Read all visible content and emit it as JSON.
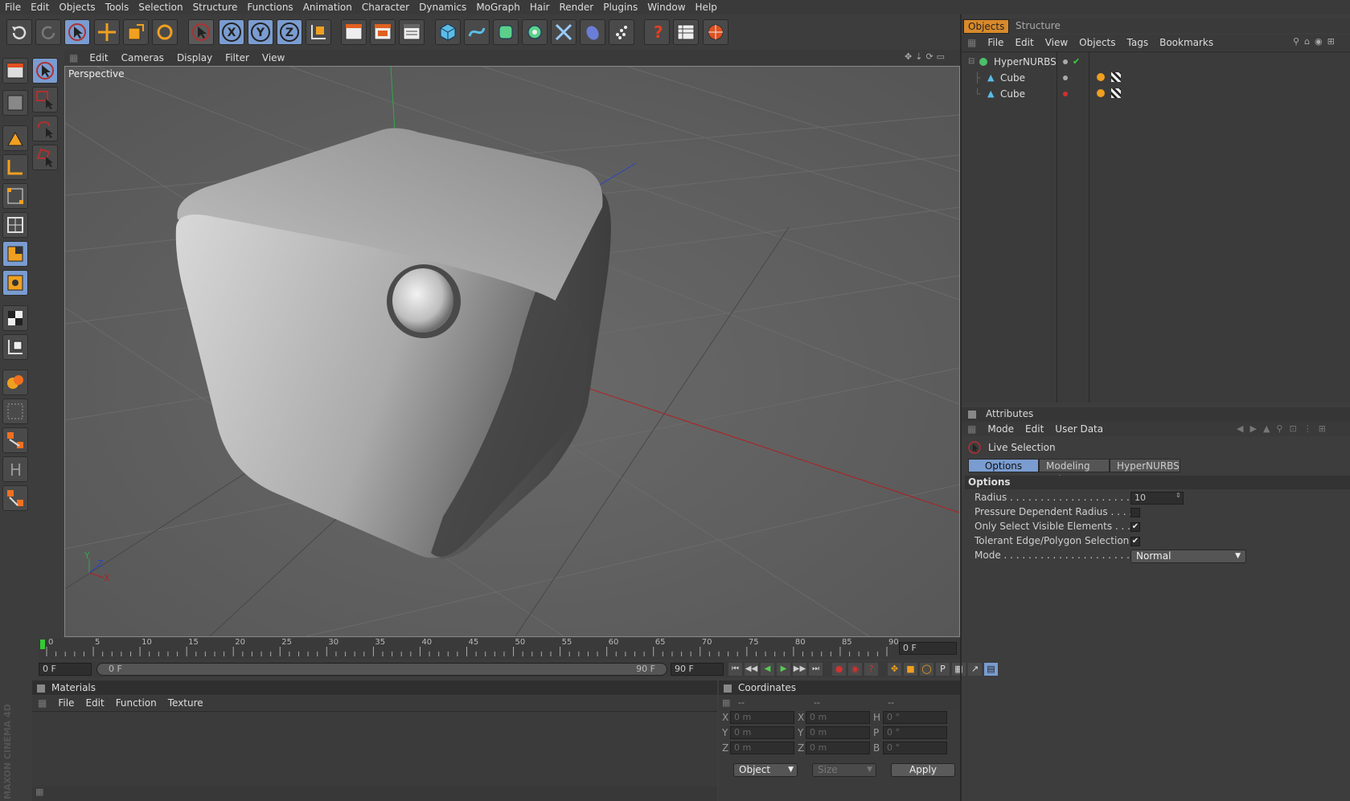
{
  "menubar": [
    "File",
    "Edit",
    "Objects",
    "Tools",
    "Selection",
    "Structure",
    "Functions",
    "Animation",
    "Character",
    "Dynamics",
    "MoGraph",
    "Hair",
    "Render",
    "Plugins",
    "Window",
    "Help"
  ],
  "toolbar": {
    "icons": [
      "undo-icon",
      "redo-icon",
      "live-selection-icon",
      "move-icon",
      "scale-icon",
      "rotate-icon",
      "last-tool-icon",
      "x-axis-icon",
      "y-axis-icon",
      "z-axis-icon",
      "coordinate-system-icon",
      "render-view-icon",
      "render-picture-viewer-icon",
      "render-settings-icon",
      "cube-primitive-icon",
      "spline-icon",
      "nurbs-icon",
      "modeling-icon",
      "deformer-icon",
      "scene-icon",
      "particles-icon",
      "help-icon",
      "timeline-icon",
      "internet-icon"
    ],
    "axis_x": "X",
    "axis_y": "Y",
    "axis_z": "Z"
  },
  "viewport": {
    "menu": [
      "Edit",
      "Cameras",
      "Display",
      "Filter",
      "View"
    ],
    "label": "Perspective",
    "axis_x": "X",
    "axis_y": "Y",
    "axis_z": "Z"
  },
  "timeline": {
    "ticks": [
      "0",
      "5",
      "10",
      "15",
      "20",
      "25",
      "30",
      "35",
      "40",
      "45",
      "50",
      "55",
      "60",
      "65",
      "70",
      "75",
      "80",
      "85",
      "90"
    ],
    "current_frame": "0 F",
    "start_field": "0 F",
    "range_start": "0 F",
    "range_end": "90 F",
    "end_field": "90 F"
  },
  "materials": {
    "title": "Materials",
    "menu": [
      "File",
      "Edit",
      "Function",
      "Texture"
    ]
  },
  "coordinates": {
    "title": "Coordinates",
    "col_headers": [
      "--",
      "--",
      "--"
    ],
    "rows": [
      {
        "a": "X",
        "av": "0 m",
        "b": "X",
        "bv": "0 m",
        "c": "H",
        "cv": "0 °"
      },
      {
        "a": "Y",
        "av": "0 m",
        "b": "Y",
        "bv": "0 m",
        "c": "P",
        "cv": "0 °"
      },
      {
        "a": "Z",
        "av": "0 m",
        "b": "Z",
        "bv": "0 m",
        "c": "B",
        "cv": "0 °"
      }
    ],
    "mode_select": "Object",
    "size_select": "Size",
    "apply_label": "Apply"
  },
  "objects_panel": {
    "tabs": [
      "Objects",
      "Structure"
    ],
    "menu": [
      "File",
      "Edit",
      "View",
      "Objects",
      "Tags",
      "Bookmarks"
    ],
    "items": [
      {
        "name": "HyperNURBS",
        "level": 0
      },
      {
        "name": "Cube",
        "level": 1
      },
      {
        "name": "Cube",
        "level": 1
      }
    ]
  },
  "attributes": {
    "title": "Attributes",
    "menu": [
      "Mode",
      "Edit",
      "User Data"
    ],
    "tool_name": "Live Selection",
    "tabs": [
      "Options",
      "Modeling Axis",
      "HyperNURBS"
    ],
    "section": "Options",
    "rows": [
      {
        "label": "Radius . . . . . . . . . . . . . . . . . . . . . .",
        "value": "10"
      },
      {
        "label": "Pressure Dependent Radius . . . .",
        "checked": false
      },
      {
        "label": "Only Select Visible Elements . . .",
        "checked": true
      },
      {
        "label": "Tolerant Edge/Polygon Selection",
        "checked": true
      },
      {
        "label": "Mode . . . . . . . . . . . . . . . . . . . . . . . .",
        "value": "Normal"
      }
    ]
  },
  "branding": "MAXON CINEMA 4D",
  "colors": {
    "accent": "#7a9cd0",
    "active_tab": "#d88a2a",
    "x_axis": "#c0392b",
    "y_axis": "#27ae60",
    "z_axis": "#2b45c0"
  }
}
